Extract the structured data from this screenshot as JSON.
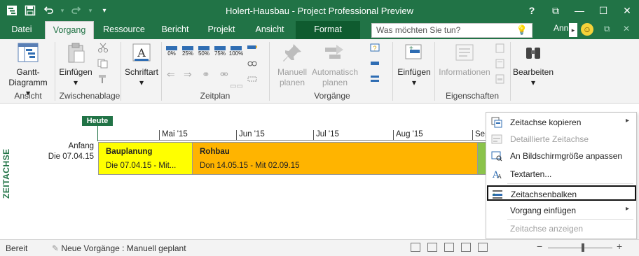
{
  "titlebar": {
    "title": "Holert-Hausbau - Project Professional Preview",
    "help": "?",
    "ribbon_display": "⧉",
    "minimize": "—",
    "maximize": "☐",
    "close": "✕"
  },
  "qat": {
    "app_icon": "project-app-icon",
    "save": "save-icon",
    "undo": "undo-icon",
    "redo": "redo-icon",
    "customize": "▾"
  },
  "tabs": [
    {
      "label": "Datei"
    },
    {
      "label": "Vorgang"
    },
    {
      "label": "Ressource"
    },
    {
      "label": "Bericht"
    },
    {
      "label": "Projekt"
    },
    {
      "label": "Ansicht"
    },
    {
      "label": "Format"
    }
  ],
  "tellme": {
    "placeholder": "Was möchten Sie tun?"
  },
  "user": {
    "name": "Ann"
  },
  "ribbon": {
    "gantt": {
      "line1": "Gantt-",
      "line2": "Diagramm ▾"
    },
    "einfuegen": {
      "label": "Einfügen",
      "arrow": "▾"
    },
    "schriftart": {
      "label": "Schriftart",
      "arrow": "▾"
    },
    "pct": [
      "0%",
      "25%",
      "50%",
      "75%",
      "100%"
    ],
    "manuell": {
      "line1": "Manuell",
      "line2": "planen"
    },
    "automatisch": {
      "line1": "Automatisch",
      "line2": "planen"
    },
    "einfuegen2": {
      "label": "Einfügen",
      "arrow": "▾"
    },
    "informationen": {
      "label": "Informationen"
    },
    "bearbeiten": {
      "label": "Bearbeiten",
      "arrow": "▾"
    },
    "groups": {
      "ansicht": "Ansicht",
      "zwischenablage": "Zwischenablage",
      "zeitplan": "Zeitplan",
      "vorgaenge": "Vorgänge",
      "eigenschaften": "Eigenschaften"
    }
  },
  "timeline": {
    "side_label": "ZEITACHSE",
    "today": "Heute",
    "start_label": "Anfang",
    "start_date": "Die 07.04.15",
    "months": [
      "Mai '15",
      "Jun '15",
      "Jul '15",
      "Aug '15",
      "Sep"
    ],
    "bars": [
      {
        "title": "Bauplanung",
        "dates": "Die 07.04.15 - Mit...",
        "color": "#ffff00"
      },
      {
        "title": "Rohbau",
        "dates": "Don 14.05.15 - Mit 02.09.15",
        "color": "#ffb400"
      }
    ],
    "colors": {
      "accent": "#217346",
      "green_bar": "#8bc34a"
    }
  },
  "context_menu": {
    "items": [
      {
        "label": "Zeitachse kopieren",
        "submenu": "▸",
        "icon": "copy-timeline-icon"
      },
      {
        "label": "Detaillierte Zeitachse",
        "icon": "detailed-timeline-icon"
      },
      {
        "label": "An Bildschirmgröße anpassen",
        "icon": "fit-screen-icon"
      },
      {
        "label": "Textarten...",
        "icon": "text-styles-icon"
      },
      {
        "label": "Zeitachsenbalken",
        "icon": "timeline-bar-icon"
      },
      {
        "label": "Vorgang einfügen",
        "submenu": "▸"
      },
      {
        "label": "Zeitachse anzeigen"
      }
    ]
  },
  "statusbar": {
    "ready": "Bereit",
    "new_tasks": "Neue Vorgänge : Manuell geplant",
    "zoom_minus": "−",
    "zoom_plus": "+"
  }
}
